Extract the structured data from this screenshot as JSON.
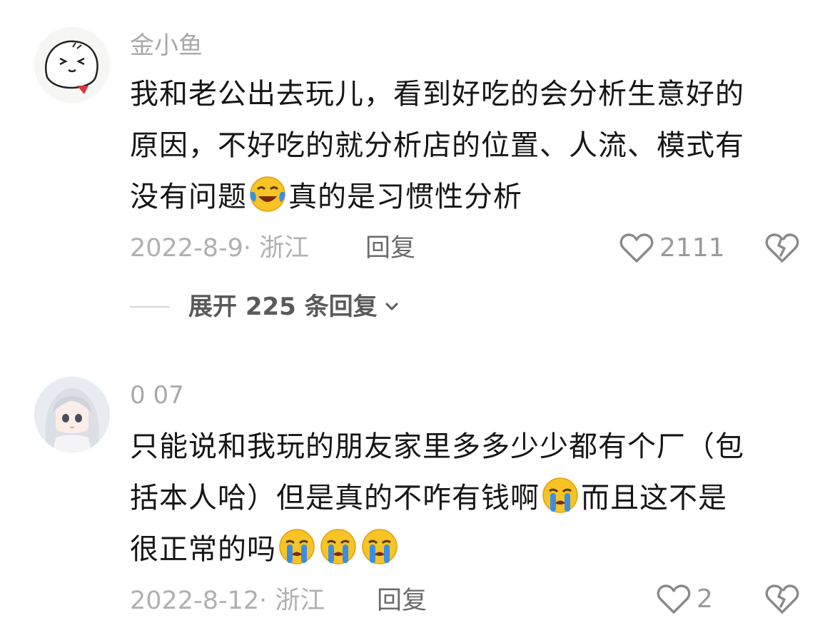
{
  "comments": [
    {
      "username": "金小鱼",
      "avatar_icon": "doodle-avatar-icon",
      "lines": [
        "我和老公出去玩儿，看到好吃的会分析生意好的",
        "原因，不好吃的就分析店的位置、人流、模式有",
        "没有问题",
        "真的是习惯性分析"
      ],
      "meta": "2022-8-9· 浙江",
      "reply_label": "回复",
      "like_count": "2111",
      "expand_label": "展开 225 条回复"
    },
    {
      "username": "0 07",
      "avatar_icon": "anime-girl-avatar-icon",
      "lines": [
        "只能说和我玩的朋友家里多多少少都有个厂（包",
        "括本人哈）但是真的不咋有钱啊",
        "而且这不是",
        "很正常的吗"
      ],
      "meta": "2022-8-12· 浙江",
      "reply_label": "回复",
      "like_count": "2"
    }
  ],
  "colors": {
    "meta_gray": "#b0b0b0",
    "text_dark": "#161616",
    "emoji_yellow": "#f7c325",
    "emoji_tear": "#3a8ee6"
  }
}
